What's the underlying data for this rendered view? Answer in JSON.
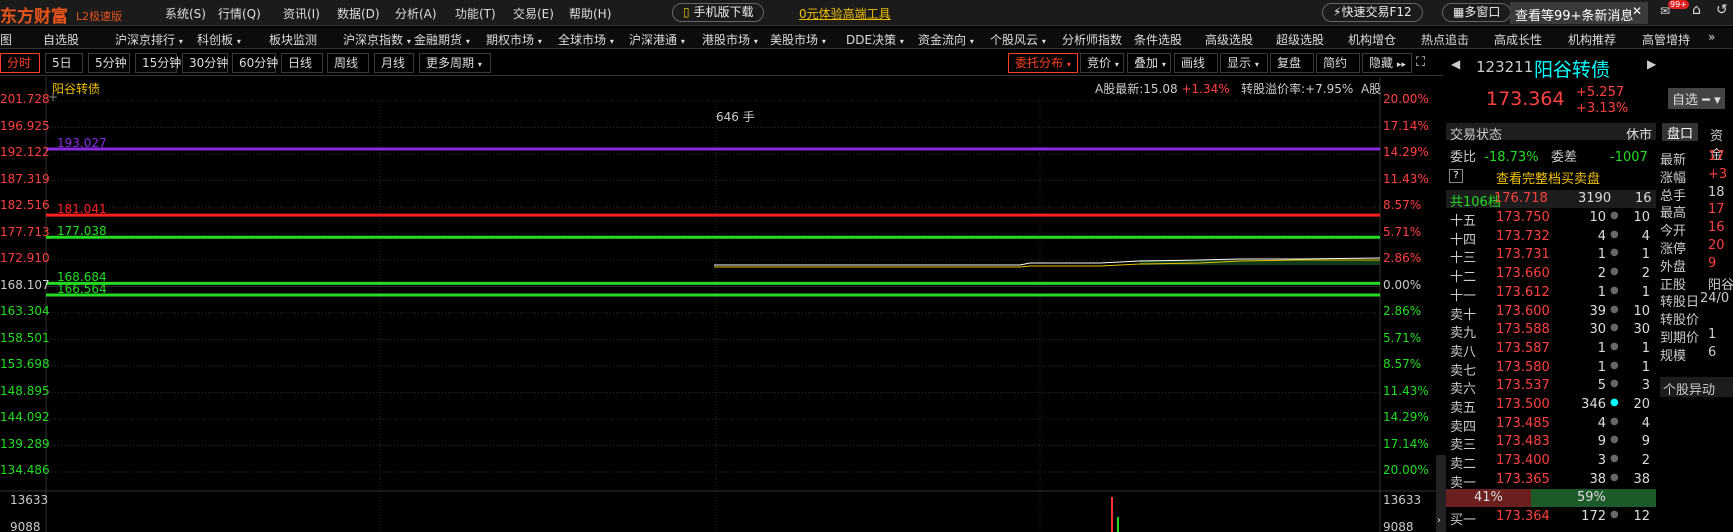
{
  "app": {
    "logo": "东方财富",
    "edition": "L2极速版"
  },
  "menu": [
    "系统(S)",
    "行情(Q)",
    "资讯(I)",
    "数据(D)",
    "分析(A)",
    "功能(T)",
    "交易(E)",
    "帮助(H)"
  ],
  "mobile_download": "手机版下载",
  "promo": "0元体验高端工具",
  "quick_trade": "快速交易F12",
  "multi_window": "多窗口",
  "news": "查看等99+条新消息",
  "badge": "99+",
  "nav2": [
    "图",
    "自选股",
    "沪深京排行",
    "科创板",
    "板块监测",
    "沪深京指数",
    "金融期货",
    "期权市场",
    "全球市场",
    "沪深港通",
    "港股市场",
    "美股市场",
    "DDE决策",
    "资金流向",
    "个股风云",
    "分析师指数",
    "条件选股",
    "高级选股",
    "超级选股",
    "机构增仓",
    "热点追击",
    "高成长性",
    "机构推荐",
    "高管增持"
  ],
  "periods": [
    "分时",
    "5日",
    "5分钟",
    "15分钟",
    "30分钟",
    "60分钟",
    "日线",
    "周线",
    "月线",
    "更多周期"
  ],
  "toolbar": {
    "entrust": "委托分布",
    "auction": "竞价",
    "overlay": "叠加",
    "draw": "画线",
    "display": "显示",
    "review": "复盘",
    "simple": "简约",
    "hide": "隐藏"
  },
  "stock": {
    "name": "阳谷转债",
    "code": "123211",
    "price": "173.364",
    "change": "+5.257",
    "change_pct": "+3.13%",
    "watch": "自选"
  },
  "info": {
    "a_latest": "A股最新:15.08",
    "a_pct": "+1.34%",
    "premium": "转股溢价率:+7.95%",
    "a_suffix": "A股",
    "vol_label": "646 手"
  },
  "y_left": [
    "201.728",
    "196.925",
    "192.122",
    "187.319",
    "182.516",
    "177.713",
    "172.910",
    "168.107",
    "163.304",
    "158.501",
    "153.698",
    "148.895",
    "144.092",
    "139.289",
    "134.486"
  ],
  "y_right": [
    "20.00%",
    "17.14%",
    "14.29%",
    "11.43%",
    "8.57%",
    "5.71%",
    "2.86%",
    "0.00%",
    "2.86%",
    "5.71%",
    "8.57%",
    "11.43%",
    "14.29%",
    "17.14%",
    "20.00%"
  ],
  "hlines": [
    {
      "label": "193.027",
      "color": "#8a2be2"
    },
    {
      "label": "181.041",
      "color": "#ff2020"
    },
    {
      "label": "177.038",
      "color": "#22dd22"
    },
    {
      "label": "168.684",
      "color": "#22dd22"
    },
    {
      "label": "166.564",
      "color": "#22dd22"
    }
  ],
  "vol_ticks": [
    "13633",
    "9088"
  ],
  "trade_status": {
    "label": "交易状态",
    "value": "休市"
  },
  "weibi": {
    "label": "委比",
    "value": "-18.73%",
    "cha_label": "委差",
    "cha_value": "-1007"
  },
  "full_book": "查看完整档买卖盘",
  "total": {
    "label": "共106档",
    "price": "176.718",
    "vol": "3190",
    "cnt": "16"
  },
  "asks": [
    [
      "十五",
      "173.750",
      "10",
      "10"
    ],
    [
      "十四",
      "173.732",
      "4",
      "4"
    ],
    [
      "十三",
      "173.731",
      "1",
      "1"
    ],
    [
      "十二",
      "173.660",
      "2",
      "2"
    ],
    [
      "十一",
      "173.612",
      "1",
      "1"
    ],
    [
      "卖十",
      "173.600",
      "39",
      "10"
    ],
    [
      "卖九",
      "173.588",
      "30",
      "30"
    ],
    [
      "卖八",
      "173.587",
      "1",
      "1"
    ],
    [
      "卖七",
      "173.580",
      "1",
      "1"
    ],
    [
      "卖六",
      "173.537",
      "5",
      "3"
    ],
    [
      "卖五",
      "173.500",
      "346",
      "20"
    ],
    [
      "卖四",
      "173.485",
      "4",
      "4"
    ],
    [
      "卖三",
      "173.483",
      "9",
      "9"
    ],
    [
      "卖二",
      "173.400",
      "3",
      "2"
    ],
    [
      "卖一",
      "173.365",
      "38",
      "38"
    ]
  ],
  "ratio": {
    "left": "41%",
    "right": "59%"
  },
  "bid1": [
    "买一",
    "173.364",
    "172",
    "12"
  ],
  "tabs": [
    "盘口",
    "资金"
  ],
  "quote": [
    [
      "最新",
      "17"
    ],
    [
      "涨幅",
      "+3"
    ],
    [
      "总手",
      "18"
    ],
    [
      "最高",
      "17"
    ],
    [
      "今开",
      "16"
    ],
    [
      "涨停",
      "20"
    ],
    [
      "外盘",
      "9"
    ],
    [
      "正股",
      "阳谷"
    ],
    [
      "转股日",
      "24/0"
    ],
    [
      "转股价",
      ""
    ],
    [
      "到期价",
      "1"
    ],
    [
      "规模",
      "6"
    ]
  ],
  "abnormal": "个股异动"
}
